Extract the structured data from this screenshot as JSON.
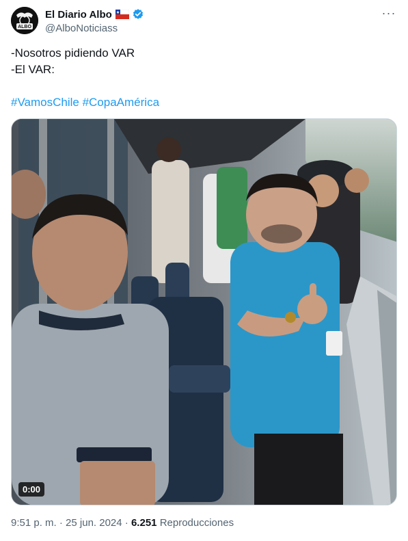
{
  "author": {
    "display_name": "El Diario Albo",
    "handle": "@AlboNoticiass",
    "avatar_text": "ALBO",
    "flag_icon": "chile-flag-icon",
    "verified_icon": "verified-badge-icon"
  },
  "menu": {
    "more_label": "···"
  },
  "tweet": {
    "line1": "-Nosotros pidiendo VAR",
    "line2": "-El VAR:",
    "hashtag1": "#VamosChile",
    "hashtag2": "#CopaAmérica"
  },
  "media": {
    "duration": "0:00"
  },
  "meta": {
    "time": "9:51 p. m.",
    "separator": " · ",
    "date": "25 jun. 2024",
    "views_count": "6.251",
    "views_label": "Reproducciones"
  },
  "colors": {
    "link": "#1d9bf0",
    "verified": "#1d9bf0",
    "muted": "#536471"
  }
}
